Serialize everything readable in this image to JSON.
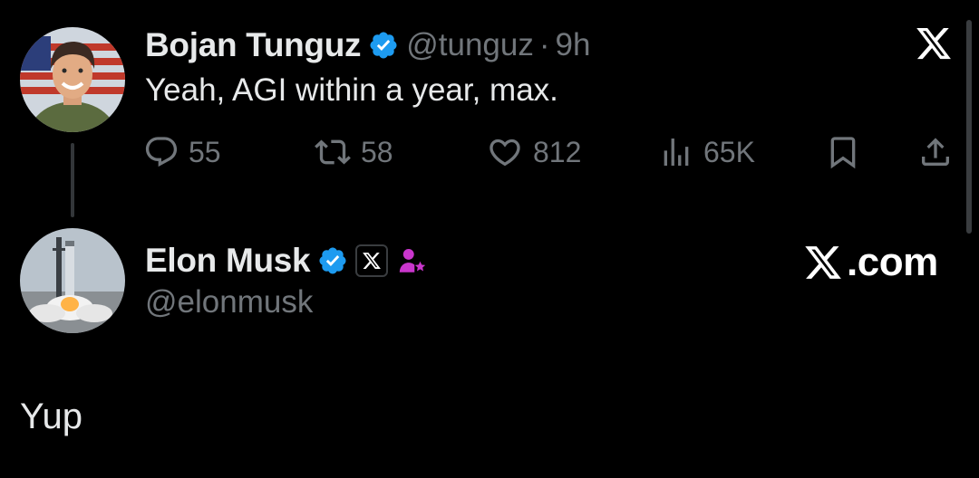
{
  "tweet": {
    "author_name": "Bojan Tunguz",
    "handle": "@tunguz",
    "separator": "·",
    "time": "9h",
    "text": "Yeah, AGI within a year, max.",
    "actions": {
      "replies": "55",
      "reposts": "58",
      "likes": "812",
      "views": "65K"
    }
  },
  "reply": {
    "author_name": "Elon Musk",
    "handle": "@elonmusk",
    "site_label": ".com",
    "text": "Yup"
  },
  "colors": {
    "background": "#000000",
    "text": "#e7e9ea",
    "secondary_text": "#71767b",
    "verified_blue": "#1d9bf0",
    "affiliate_purple": "#c936cc"
  },
  "icons": [
    "close-x-icon",
    "verified-badge-icon",
    "reply-icon",
    "repost-icon",
    "like-icon",
    "views-icon",
    "bookmark-icon",
    "share-icon",
    "x-logo-badge-icon",
    "affiliate-person-icon",
    "x-logo-icon"
  ]
}
